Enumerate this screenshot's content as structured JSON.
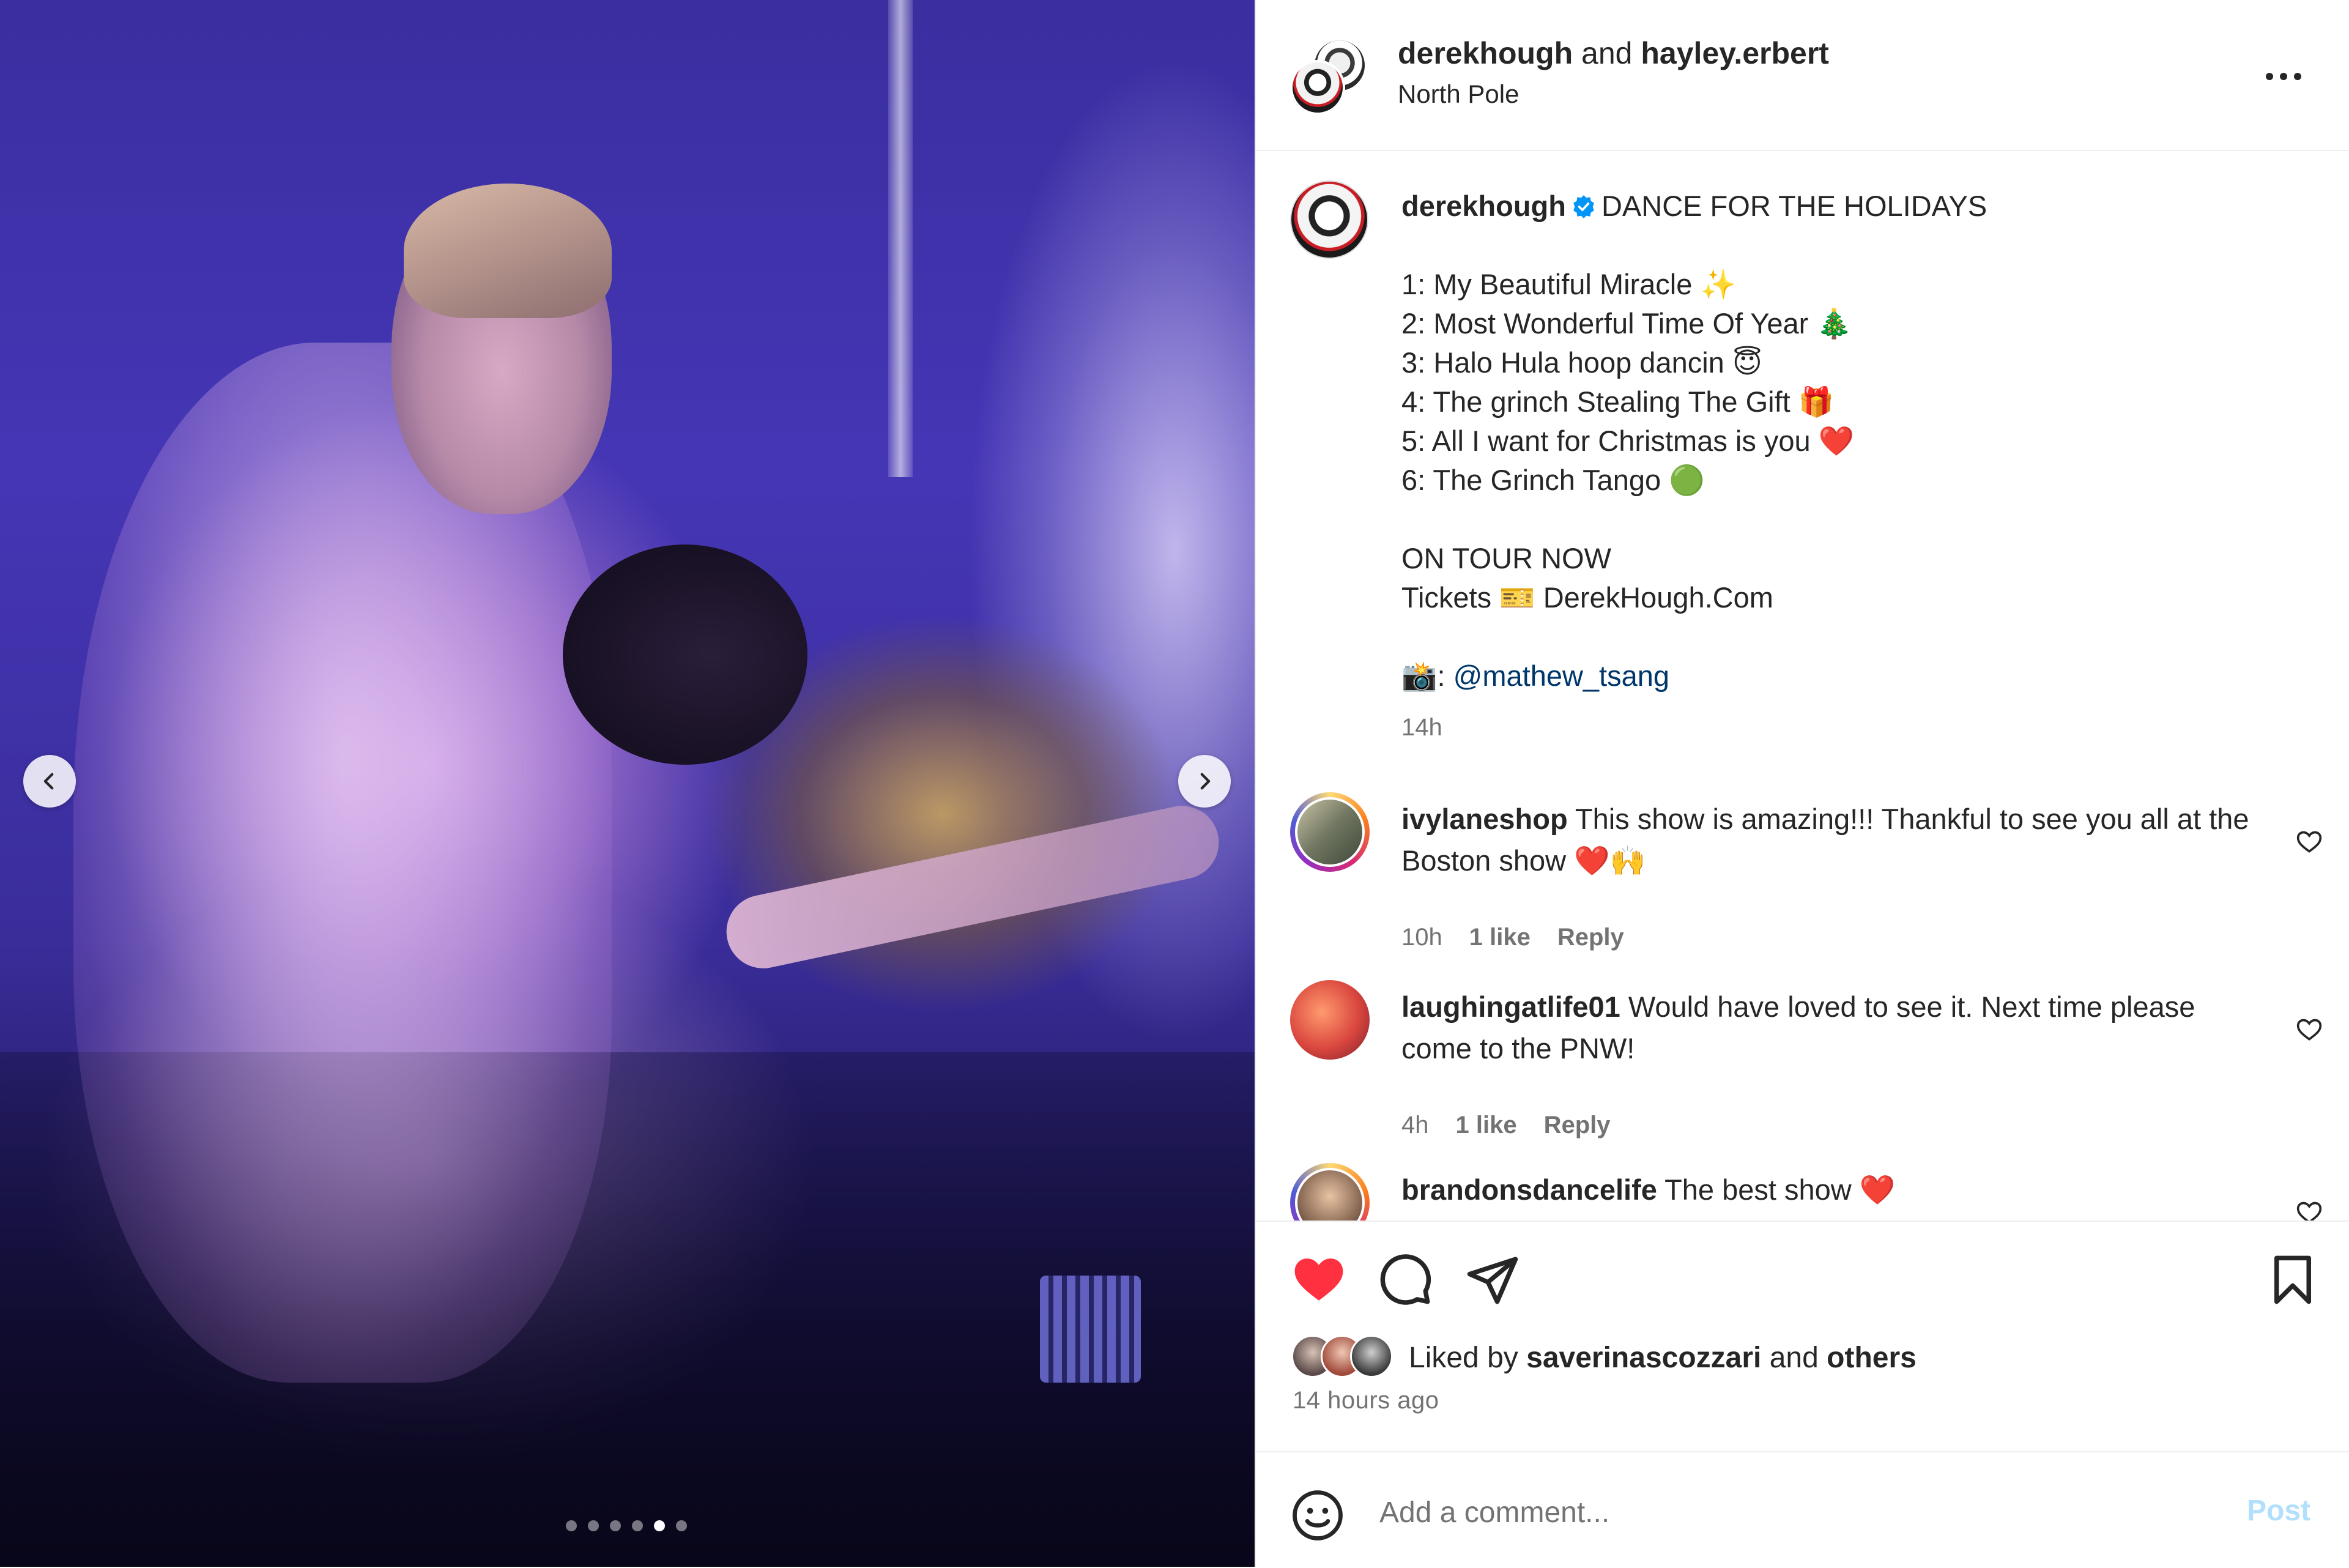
{
  "post": {
    "header": {
      "user1": "derekhough",
      "conjunction": "and",
      "user2": "hayley.erbert",
      "location": "North Pole",
      "more_icon": "more-horizontal-icon"
    },
    "caption": {
      "username": "derekhough",
      "title": "DANCE FOR THE HOLIDAYS",
      "list": [
        "1: My Beautiful Miracle ✨",
        "2: Most Wonderful Time Of Year 🎄",
        "3: Halo Hula hoop dancin 😇",
        "4: The grinch Stealing The Gift 🎁",
        "5: All I want for Christmas is you ❤️",
        "6: The Grinch Tango 🟢"
      ],
      "tour_line": "ON TOUR NOW",
      "tickets_line": "Tickets 🎫 DerekHough.Com",
      "credit_prefix": "📸: ",
      "credit_mention": "@mathew_tsang",
      "time": "14h"
    },
    "comments": [
      {
        "username": "ivylaneshop",
        "text": "This show is amazing!!! Thankful to see you all at the Boston show ❤️🙌",
        "time": "10h",
        "likes": "1 like",
        "reply": "Reply"
      },
      {
        "username": "laughingatlife01",
        "text": "Would have loved to see it. Next time please come to the PNW!",
        "time": "4h",
        "likes": "1 like",
        "reply": "Reply"
      },
      {
        "username": "brandonsdancelife",
        "text": "The best show ❤️"
      }
    ],
    "likes": {
      "prefix": "Liked by",
      "user": "saverinascozzari",
      "conjunction": "and",
      "others": "others"
    },
    "timestamp": "14 hours ago",
    "comment_input": {
      "placeholder": "Add a comment...",
      "post_label": "Post"
    }
  },
  "carousel": {
    "total": 6,
    "active_index": 4
  },
  "colors": {
    "like_red": "#ff3040",
    "link_blue": "#00376b",
    "verified_blue": "#0095f6",
    "post_disabled": "#b2dffc"
  }
}
